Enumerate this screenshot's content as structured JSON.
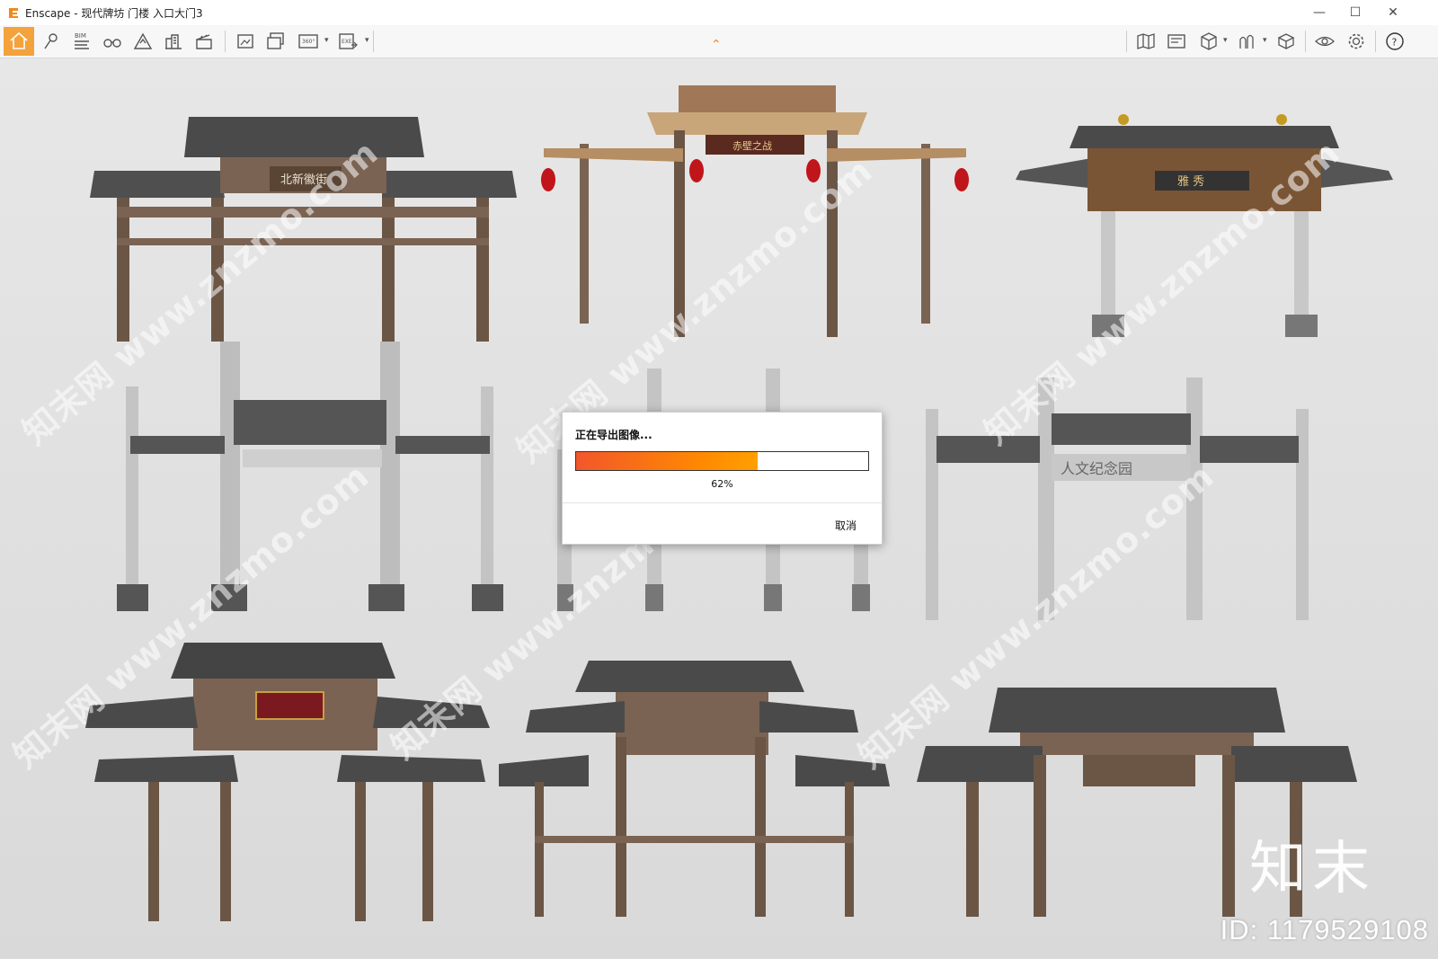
{
  "window": {
    "title": "Enscape - 现代牌坊 门楼 入口大门3",
    "controls": {
      "minimize": "—",
      "maximize": "☐",
      "close": "✕"
    }
  },
  "toolbar": {
    "left_icons": [
      "home-icon",
      "pin-icon",
      "bim-icon",
      "binoculars-icon",
      "mountain-icon",
      "buildings-icon",
      "clapper-icon",
      "screenshot-icon",
      "batch-render-icon",
      "panorama-360-icon",
      "exe-export-icon"
    ],
    "right_icons": [
      "map-icon",
      "video-editor-icon",
      "cube-icon",
      "people-icon",
      "asset-library-icon",
      "visual-settings-icon",
      "settings-icon",
      "help-icon"
    ],
    "bim_label": "BIM",
    "pano_label": "360°",
    "exe_label": "EXE",
    "help_label": "?"
  },
  "dialog": {
    "title": "正在导出图像...",
    "progress": 0.62,
    "progress_label": "62%",
    "cancel_label": "取消"
  },
  "gate_signs": {
    "gate1": "北新徽街",
    "gate2": "赤壁之战",
    "gate3": "雅 秀",
    "gate6": "人文纪念园"
  },
  "watermarks": {
    "text": "知末网 www.znzmo.com",
    "brand": "知末",
    "id": "ID: 1179529108"
  },
  "colors": {
    "accent": "#f4a23c",
    "progress_start": "#f2572b",
    "progress_end": "#ffa000",
    "wood": "#6b5646",
    "roof": "#555555",
    "stone": "#bdbdbd"
  }
}
